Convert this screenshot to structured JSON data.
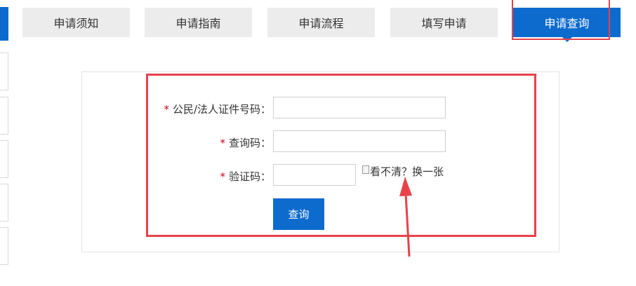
{
  "tabs": [
    {
      "label": "申请须知",
      "active": false
    },
    {
      "label": "申请指南",
      "active": false
    },
    {
      "label": "申请流程",
      "active": false
    },
    {
      "label": "填写申请",
      "active": false
    },
    {
      "label": "申请查询",
      "active": true
    }
  ],
  "form": {
    "required_mark": "*",
    "id_label": "公民/法人证件号码：",
    "id_value": "",
    "query_code_label": "查询码：",
    "query_code_value": "",
    "captcha_label": "验证码：",
    "captcha_value": "",
    "captcha_image_alt": "看不清？换一张",
    "submit_label": "查询"
  },
  "colors": {
    "accent": "#0d6bce",
    "annotation": "#e8424a",
    "required": "#d0021b"
  }
}
